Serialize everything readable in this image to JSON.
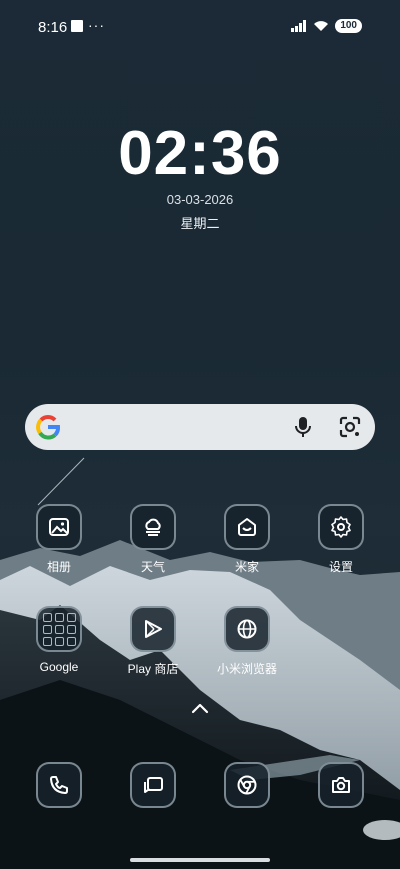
{
  "status_bar": {
    "time": "8:16",
    "dots": "···",
    "battery": "100"
  },
  "lockscreen": {
    "clock": "02:36",
    "date": "03-03-2026",
    "weekday": "星期二"
  },
  "search": {
    "icons": [
      "google-g-icon",
      "microphone-icon",
      "google-lens-icon"
    ]
  },
  "apps_row1": [
    {
      "label": "相册",
      "icon": "gallery-icon"
    },
    {
      "label": "天气",
      "icon": "weather-icon"
    },
    {
      "label": "米家",
      "icon": "mi-home-icon"
    },
    {
      "label": "设置",
      "icon": "settings-gear-icon"
    }
  ],
  "apps_row2": [
    {
      "label": "Google",
      "icon": "folder-icon"
    },
    {
      "label": "Play 商店",
      "icon": "play-store-icon"
    },
    {
      "label": "小米浏览器",
      "icon": "browser-globe-icon"
    }
  ],
  "dock": [
    {
      "icon": "phone-icon"
    },
    {
      "icon": "messages-icon"
    },
    {
      "icon": "chrome-icon"
    },
    {
      "icon": "camera-icon"
    }
  ]
}
